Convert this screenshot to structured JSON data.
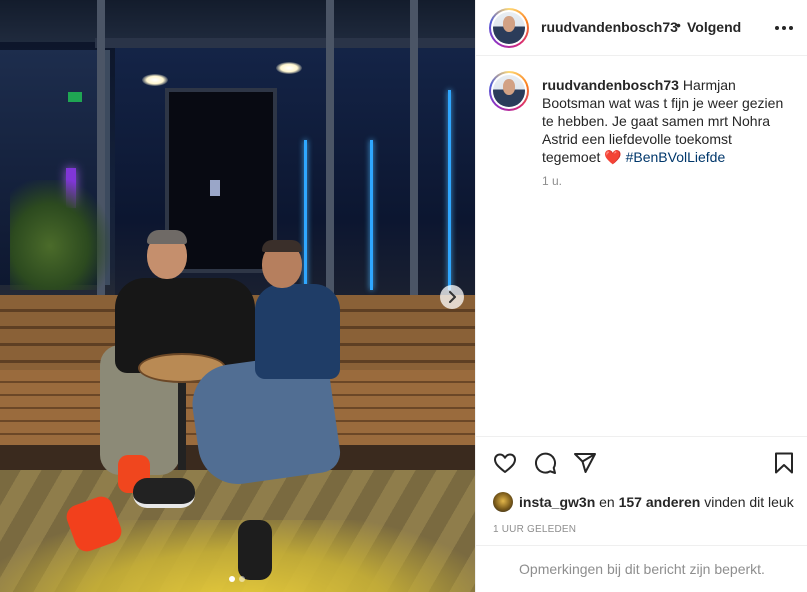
{
  "post": {
    "username": "ruudvandenbosch73",
    "separator": "•",
    "follow_label": "Volgend",
    "caption": {
      "username": "ruudvandenbosch73",
      "text": "Harmjan Bootsman wat was t fijn je weer gezien te hebben. Je gaat samen mrt Nohra Astrid een liefdevolle toekomst tegemoet",
      "emoji": "❤️",
      "hashtag": "#BenBVolLiefde",
      "time": "1 u."
    },
    "likes": {
      "first_user": "insta_gw3n",
      "connector": "en",
      "others": "157 anderen",
      "suffix": "vinden dit leuk"
    },
    "timestamp": "1 UUR GELEDEN",
    "comments_notice": "Opmerkingen bij dit bericht zijn beperkt."
  },
  "carousel": {
    "total_slides": 2,
    "current_slide": 1
  },
  "icons": {
    "more": "more-options-icon",
    "next": "chevron-right-icon",
    "like": "heart-icon",
    "comment": "comment-icon",
    "share": "paper-plane-icon",
    "save": "bookmark-icon"
  },
  "colors": {
    "link": "#00376b",
    "secondary_text": "#8e8e8e",
    "primary_text": "#262626",
    "heart": "#e0161d"
  }
}
